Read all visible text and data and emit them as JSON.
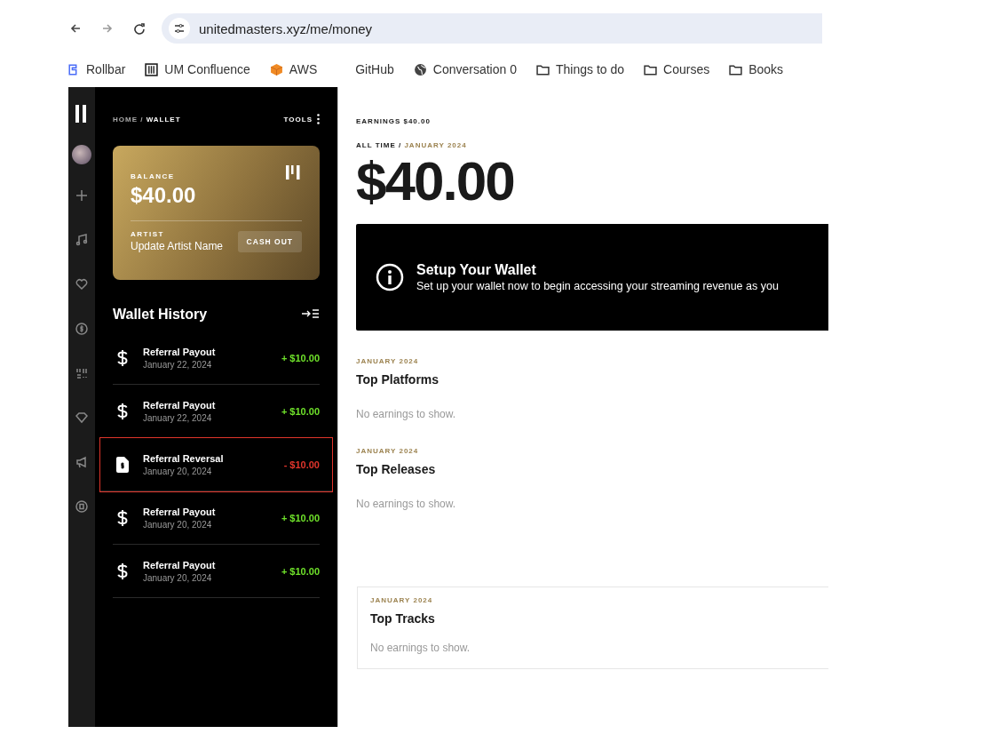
{
  "browser": {
    "url": "unitedmasters.xyz/me/money",
    "bookmarks": [
      {
        "label": "Rollbar",
        "kind": "rollbar"
      },
      {
        "label": "UM Confluence",
        "kind": "bars"
      },
      {
        "label": "AWS",
        "kind": "cube"
      },
      {
        "label": "GitHub",
        "kind": "none"
      },
      {
        "label": "Conversation 0",
        "kind": "globe"
      },
      {
        "label": "Things to do",
        "kind": "folder"
      },
      {
        "label": "Courses",
        "kind": "folder"
      },
      {
        "label": "Books",
        "kind": "folder"
      }
    ]
  },
  "sidebar": {
    "breadcrumb_parent": "HOME /",
    "breadcrumb_current": "WALLET",
    "tools": "TOOLS",
    "card": {
      "balance_label": "BALANCE",
      "balance": "$40.00",
      "artist_label": "ARTIST",
      "artist_name": "Update Artist Name",
      "button": "CASH OUT"
    },
    "history_title": "Wallet History",
    "transactions": [
      {
        "title": "Referral Payout",
        "date": "January 22, 2024",
        "amount": "+ $10.00",
        "kind": "payout",
        "highlighted": false
      },
      {
        "title": "Referral Payout",
        "date": "January 22, 2024",
        "amount": "+ $10.00",
        "kind": "payout",
        "highlighted": false
      },
      {
        "title": "Referral Reversal",
        "date": "January 20, 2024",
        "amount": "- $10.00",
        "kind": "reversal",
        "highlighted": true
      },
      {
        "title": "Referral Payout",
        "date": "January 20, 2024",
        "amount": "+ $10.00",
        "kind": "payout",
        "highlighted": false
      },
      {
        "title": "Referral Payout",
        "date": "January 20, 2024",
        "amount": "+ $10.00",
        "kind": "payout",
        "highlighted": false
      }
    ]
  },
  "main": {
    "earnings_label": "EARNINGS $40.00",
    "period_all": "ALL TIME /",
    "period_current": "JANUARY 2024",
    "total": "$40.00",
    "banner": {
      "title": "Setup Your Wallet",
      "text": "Set up your wallet now to begin accessing your streaming revenue as you"
    },
    "sections": [
      {
        "period": "JANUARY 2024",
        "title": "Top Platforms",
        "empty": "No earnings to show.",
        "kind": "plain"
      },
      {
        "period": "JANUARY 2024",
        "title": "Top Releases",
        "empty": "No earnings to show.",
        "kind": "plain"
      },
      {
        "period": "JANUARY 2024",
        "title": "Top Tracks",
        "empty": "No earnings to show.",
        "kind": "card"
      }
    ]
  }
}
